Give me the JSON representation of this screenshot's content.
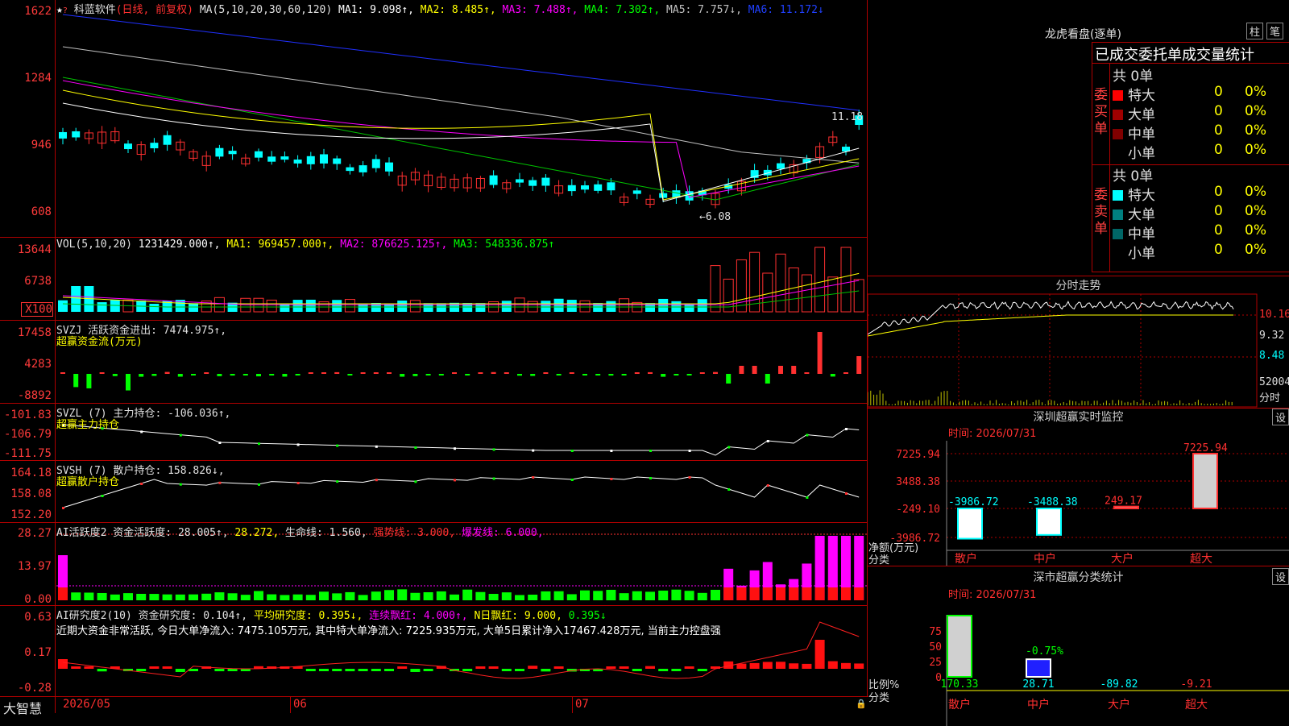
{
  "stock": {
    "name": "科蓝软件",
    "mode": "(日线, 前复权)",
    "ma_label": "MA(5,10,20,30,60,120)",
    "ma1": "MA1: 9.098↑,",
    "ma2": "MA2: 8.485↑,",
    "ma3": "MA3: 7.488↑,",
    "ma4": "MA4: 7.302↑,",
    "ma5": "MA5: 7.757↓,",
    "ma6": "MA6: 11.172↓",
    "high_label": "11.18",
    "low_label": "←6.08"
  },
  "price_axis": [
    "1622",
    "1284",
    "946",
    "608"
  ],
  "vol": {
    "title": "VOL(5,10,20)",
    "v": "1231429.000↑,",
    "ma1": "MA1: 969457.000↑,",
    "ma2": "MA2: 876625.125↑,",
    "ma3": "MA3: 548336.875↑",
    "axis": [
      "13644",
      "6738",
      "X100"
    ]
  },
  "svzj": {
    "title": "SVZJ  活跃资金进出: 7474.975↑,",
    "sub": "超赢资金流(万元)",
    "axis": [
      "17458",
      "4283",
      "-8892"
    ]
  },
  "svzl": {
    "title": "SVZL (7) 主力持仓: -106.036↑,",
    "sub": "超赢主力持仓",
    "axis": [
      "-101.83",
      "-106.79",
      "-111.75"
    ]
  },
  "svsh": {
    "title": "SVSH (7) 散户持仓: 158.826↓,",
    "sub": "超赢散户持仓",
    "axis": [
      "164.18",
      "158.08",
      "152.20"
    ]
  },
  "ai1": {
    "t1": "AI活跃度2 资金活跃度: 28.005↑,",
    "t2": "28.272,",
    "t3": "生命线: 1.560,",
    "t4": "强势线: 3.000,",
    "t5": "爆发线: 6.000,",
    "axis": [
      "28.27",
      "13.97",
      "0.00"
    ]
  },
  "ai2": {
    "t1": "AI研究度2(10) 资金研究度: 0.104↑,",
    "t2": "平均研究度: 0.395↓,",
    "t3": "连续飘红: 4.000↑,",
    "t4": "N日飘红: 9.000,",
    "t5": "0.395↓",
    "comment": "近期大资金非常活跃, 今日大单净流入: 7475.105万元, 其中特大单净流入: 7225.935万元, 大单5日累计净入17467.428万元, 当前主力控盘强",
    "axis": [
      "0.63",
      "0.17",
      "-0.28"
    ]
  },
  "footer": {
    "brand": "大智慧",
    "dates": [
      "2026/05",
      "06",
      "07"
    ]
  },
  "lhb": {
    "title": "龙虎看盘(逐单)",
    "btn1": "柱",
    "btn2": "笔",
    "header": "已成交委托单成交量统计",
    "buy_label": "委买单",
    "sell_label": "委卖单",
    "buy_total": "共 0单",
    "sell_total": "共 0单",
    "rows": [
      "特大",
      "大单",
      "中单",
      "小单"
    ],
    "zero": "0",
    "pct": "0%"
  },
  "fenshi": {
    "title": "分时走势",
    "axis": [
      "10.16",
      "9.32",
      "8.48",
      "52004",
      "分时"
    ]
  },
  "sz_monitor": {
    "title": "深圳超赢实时监控",
    "set": "设",
    "time": "时间: 2026/07/31",
    "axis": [
      "7225.94",
      "3488.38",
      "-249.10",
      "-3986.72"
    ],
    "ylabel1": "净额(万元)",
    "ylabel2": "分类",
    "bars": [
      {
        "name": "散户",
        "value": -3986.72,
        "label": "-3986.72"
      },
      {
        "name": "中户",
        "value": -3488.38,
        "label": "-3488.38"
      },
      {
        "name": "大户",
        "value": 249.17,
        "label": "249.17"
      },
      {
        "name": "超大",
        "value": 7225.94,
        "label": "7225.94"
      }
    ]
  },
  "sz_class": {
    "title": "深市超赢分类统计",
    "set": "设",
    "time": "时间: 2026/07/31",
    "axis": [
      "75",
      "50",
      "25",
      "0"
    ],
    "ylabel1": "比例%",
    "ylabel2": "分类",
    "pct_label": "-0.75%",
    "bars": [
      {
        "name": "散户",
        "value": 170.33,
        "label": "170.33"
      },
      {
        "name": "中户",
        "value": 28.71,
        "label": "28.71"
      },
      {
        "name": "大户",
        "value": -89.82,
        "label": "-89.82"
      },
      {
        "name": "超大",
        "value": -9.21,
        "label": "-9.21"
      }
    ]
  },
  "colors": {
    "up": "#ff3030",
    "down": "#00ffff",
    "green": "#00ff00",
    "magenta": "#ff00ff",
    "grid": "#b00000"
  }
}
